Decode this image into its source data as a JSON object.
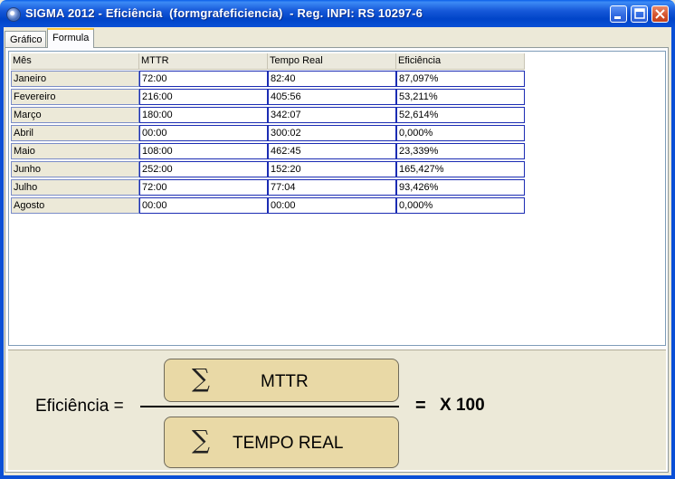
{
  "window": {
    "title": "SIGMA 2012 - Eficiência  (formgrafeficiencia)  - Reg. INPI: RS 10297-6"
  },
  "tabs": [
    {
      "label": "Gráfico",
      "active": false
    },
    {
      "label": "Formula",
      "active": true
    }
  ],
  "grid": {
    "columns": [
      "Mês",
      "MTTR",
      "Tempo Real",
      "Eficiência"
    ],
    "rows": [
      {
        "mes": "Janeiro",
        "mttr": "72:00",
        "tempo_real": "82:40",
        "eficiencia": "87,097%"
      },
      {
        "mes": "Fevereiro",
        "mttr": "216:00",
        "tempo_real": "405:56",
        "eficiencia": "53,211%"
      },
      {
        "mes": "Março",
        "mttr": "180:00",
        "tempo_real": "342:07",
        "eficiencia": "52,614%"
      },
      {
        "mes": "Abril",
        "mttr": "00:00",
        "tempo_real": "300:02",
        "eficiencia": "0,000%"
      },
      {
        "mes": "Maio",
        "mttr": "108:00",
        "tempo_real": "462:45",
        "eficiencia": "23,339%"
      },
      {
        "mes": "Junho",
        "mttr": "252:00",
        "tempo_real": "152:20",
        "eficiencia": "165,427%"
      },
      {
        "mes": "Julho",
        "mttr": "72:00",
        "tempo_real": "77:04",
        "eficiencia": "93,426%"
      },
      {
        "mes": "Agosto",
        "mttr": "00:00",
        "tempo_real": "00:00",
        "eficiencia": "0,000%"
      }
    ]
  },
  "formula": {
    "label": "Eficiência =",
    "sigma": "∑",
    "numerator": "MTTR",
    "denominator": "TEMPO REAL",
    "equals": "=",
    "multiplier": "X 100"
  },
  "colors": {
    "title_bar": "#0A4FD6",
    "formula_box": "#E9D9A6",
    "cell_border": "#1B2CB3",
    "active_tab_accent": "#FFC83C"
  }
}
